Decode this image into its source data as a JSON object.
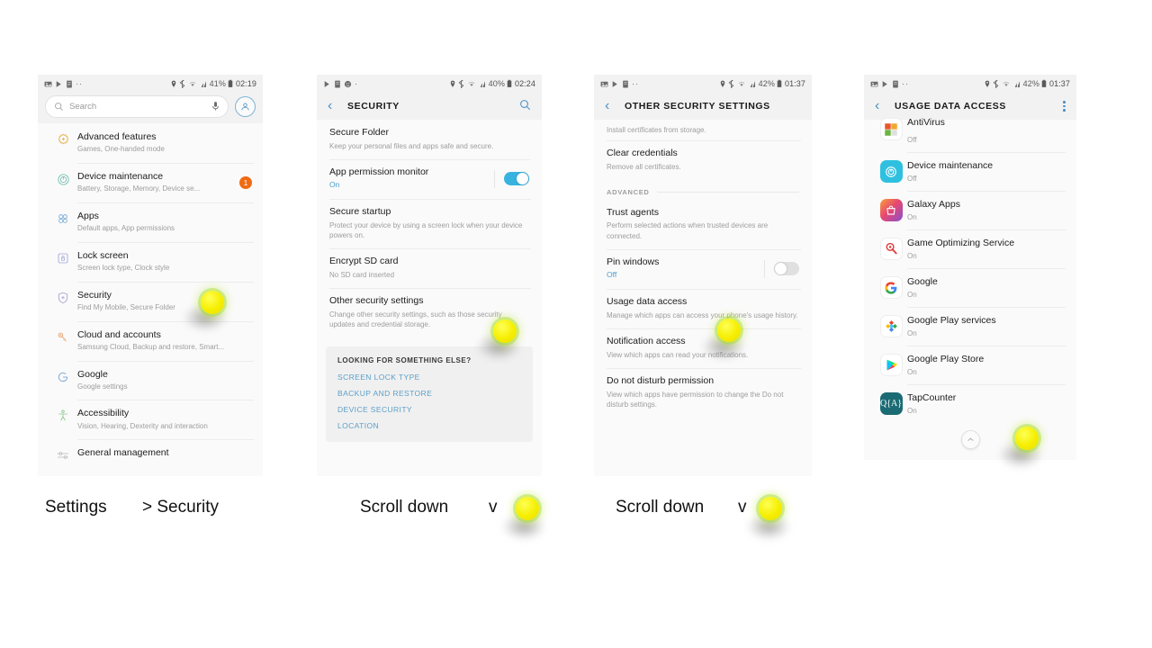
{
  "panels": [
    {
      "id": "settings-home",
      "status": {
        "time": "02:19",
        "battery": "41%"
      },
      "search": {
        "placeholder": "Search"
      },
      "items": [
        {
          "title": "Advanced features",
          "sub": "Games, One-handed mode",
          "icon": "advanced-features-icon"
        },
        {
          "title": "Device maintenance",
          "sub": "Battery, Storage, Memory, Device se...",
          "icon": "device-maintenance-icon",
          "badge": "1"
        },
        {
          "title": "Apps",
          "sub": "Default apps, App permissions",
          "icon": "apps-icon"
        },
        {
          "title": "Lock screen",
          "sub": "Screen lock type, Clock style",
          "icon": "lock-screen-icon"
        },
        {
          "title": "Security",
          "sub": "Find My Mobile, Secure Folder",
          "icon": "security-icon"
        },
        {
          "title": "Cloud and accounts",
          "sub": "Samsung Cloud, Backup and restore, Smart...",
          "icon": "cloud-accounts-icon"
        },
        {
          "title": "Google",
          "sub": "Google settings",
          "icon": "google-icon"
        },
        {
          "title": "Accessibility",
          "sub": "Vision, Hearing, Dexterity and interaction",
          "icon": "accessibility-icon"
        },
        {
          "title": "General management",
          "sub": "",
          "icon": "general-management-icon"
        }
      ]
    },
    {
      "id": "security",
      "status": {
        "time": "02:24",
        "battery": "40%"
      },
      "appbar": {
        "title": "SECURITY"
      },
      "items": [
        {
          "title": "Secure Folder",
          "sub": "Keep your personal files and apps safe and secure."
        },
        {
          "title": "App permission monitor",
          "sub": "On",
          "sub_accent": true,
          "toggle": "on"
        },
        {
          "title": "Secure startup",
          "sub": "Protect your device by using a screen lock when your device powers on."
        },
        {
          "title": "Encrypt SD card",
          "sub": "No SD card inserted"
        },
        {
          "title": "Other security settings",
          "sub": "Change other security settings, such as those security updates and credential storage."
        }
      ],
      "card": {
        "heading": "LOOKING FOR SOMETHING ELSE?",
        "links": [
          "SCREEN LOCK TYPE",
          "BACKUP AND RESTORE",
          "DEVICE SECURITY",
          "LOCATION"
        ]
      }
    },
    {
      "id": "other-security-settings",
      "status": {
        "time": "01:37",
        "battery": "42%"
      },
      "appbar": {
        "title": "OTHER SECURITY SETTINGS"
      },
      "clipped_top_sub": "Install certificates from storage.",
      "items": [
        {
          "title": "Clear credentials",
          "sub": "Remove all certificates."
        }
      ],
      "section": "ADVANCED",
      "advanced_items": [
        {
          "title": "Trust agents",
          "sub": "Perform selected actions when trusted devices are connected."
        },
        {
          "title": "Pin windows",
          "sub": "Off",
          "sub_accent": true,
          "toggle": "off"
        },
        {
          "title": "Usage data access",
          "sub": "Manage which apps can access your phone's usage history."
        },
        {
          "title": "Notification access",
          "sub": "View which apps can read your notifications."
        },
        {
          "title": "Do not disturb permission",
          "sub": "View which apps have permission to change the Do not disturb settings."
        }
      ]
    },
    {
      "id": "usage-data-access",
      "status": {
        "time": "01:37",
        "battery": "42%"
      },
      "appbar": {
        "title": "USAGE DATA ACCESS",
        "overflow": "more-options-icon"
      },
      "apps": [
        {
          "name": "AntiVirus",
          "state": "Off",
          "icon": "antivirus-app-icon",
          "clipped": true
        },
        {
          "name": "Device maintenance",
          "state": "Off",
          "icon": "device-maintenance-app-icon"
        },
        {
          "name": "Galaxy Apps",
          "state": "On",
          "icon": "galaxy-apps-app-icon"
        },
        {
          "name": "Game Optimizing Service",
          "state": "On",
          "icon": "game-optimizing-service-app-icon"
        },
        {
          "name": "Google",
          "state": "On",
          "icon": "google-app-icon"
        },
        {
          "name": "Google Play services",
          "state": "On",
          "icon": "google-play-services-app-icon"
        },
        {
          "name": "Google Play Store",
          "state": "On",
          "icon": "google-play-store-app-icon"
        },
        {
          "name": "TapCounter",
          "state": "On",
          "icon": "tapcounter-app-icon"
        }
      ]
    }
  ],
  "captions": [
    {
      "text": "Settings",
      "sub": "> Security"
    },
    {
      "text": "Scroll down",
      "chev": "v"
    },
    {
      "text": "Scroll down",
      "chev": "v"
    }
  ],
  "colors": {
    "accent_blue": "#4a90c4",
    "toggle_on": "#38b3e0",
    "badge_orange": "#f06a13",
    "tap_yellow": "#f5ee00",
    "link_blue": "#5b9fc9"
  }
}
